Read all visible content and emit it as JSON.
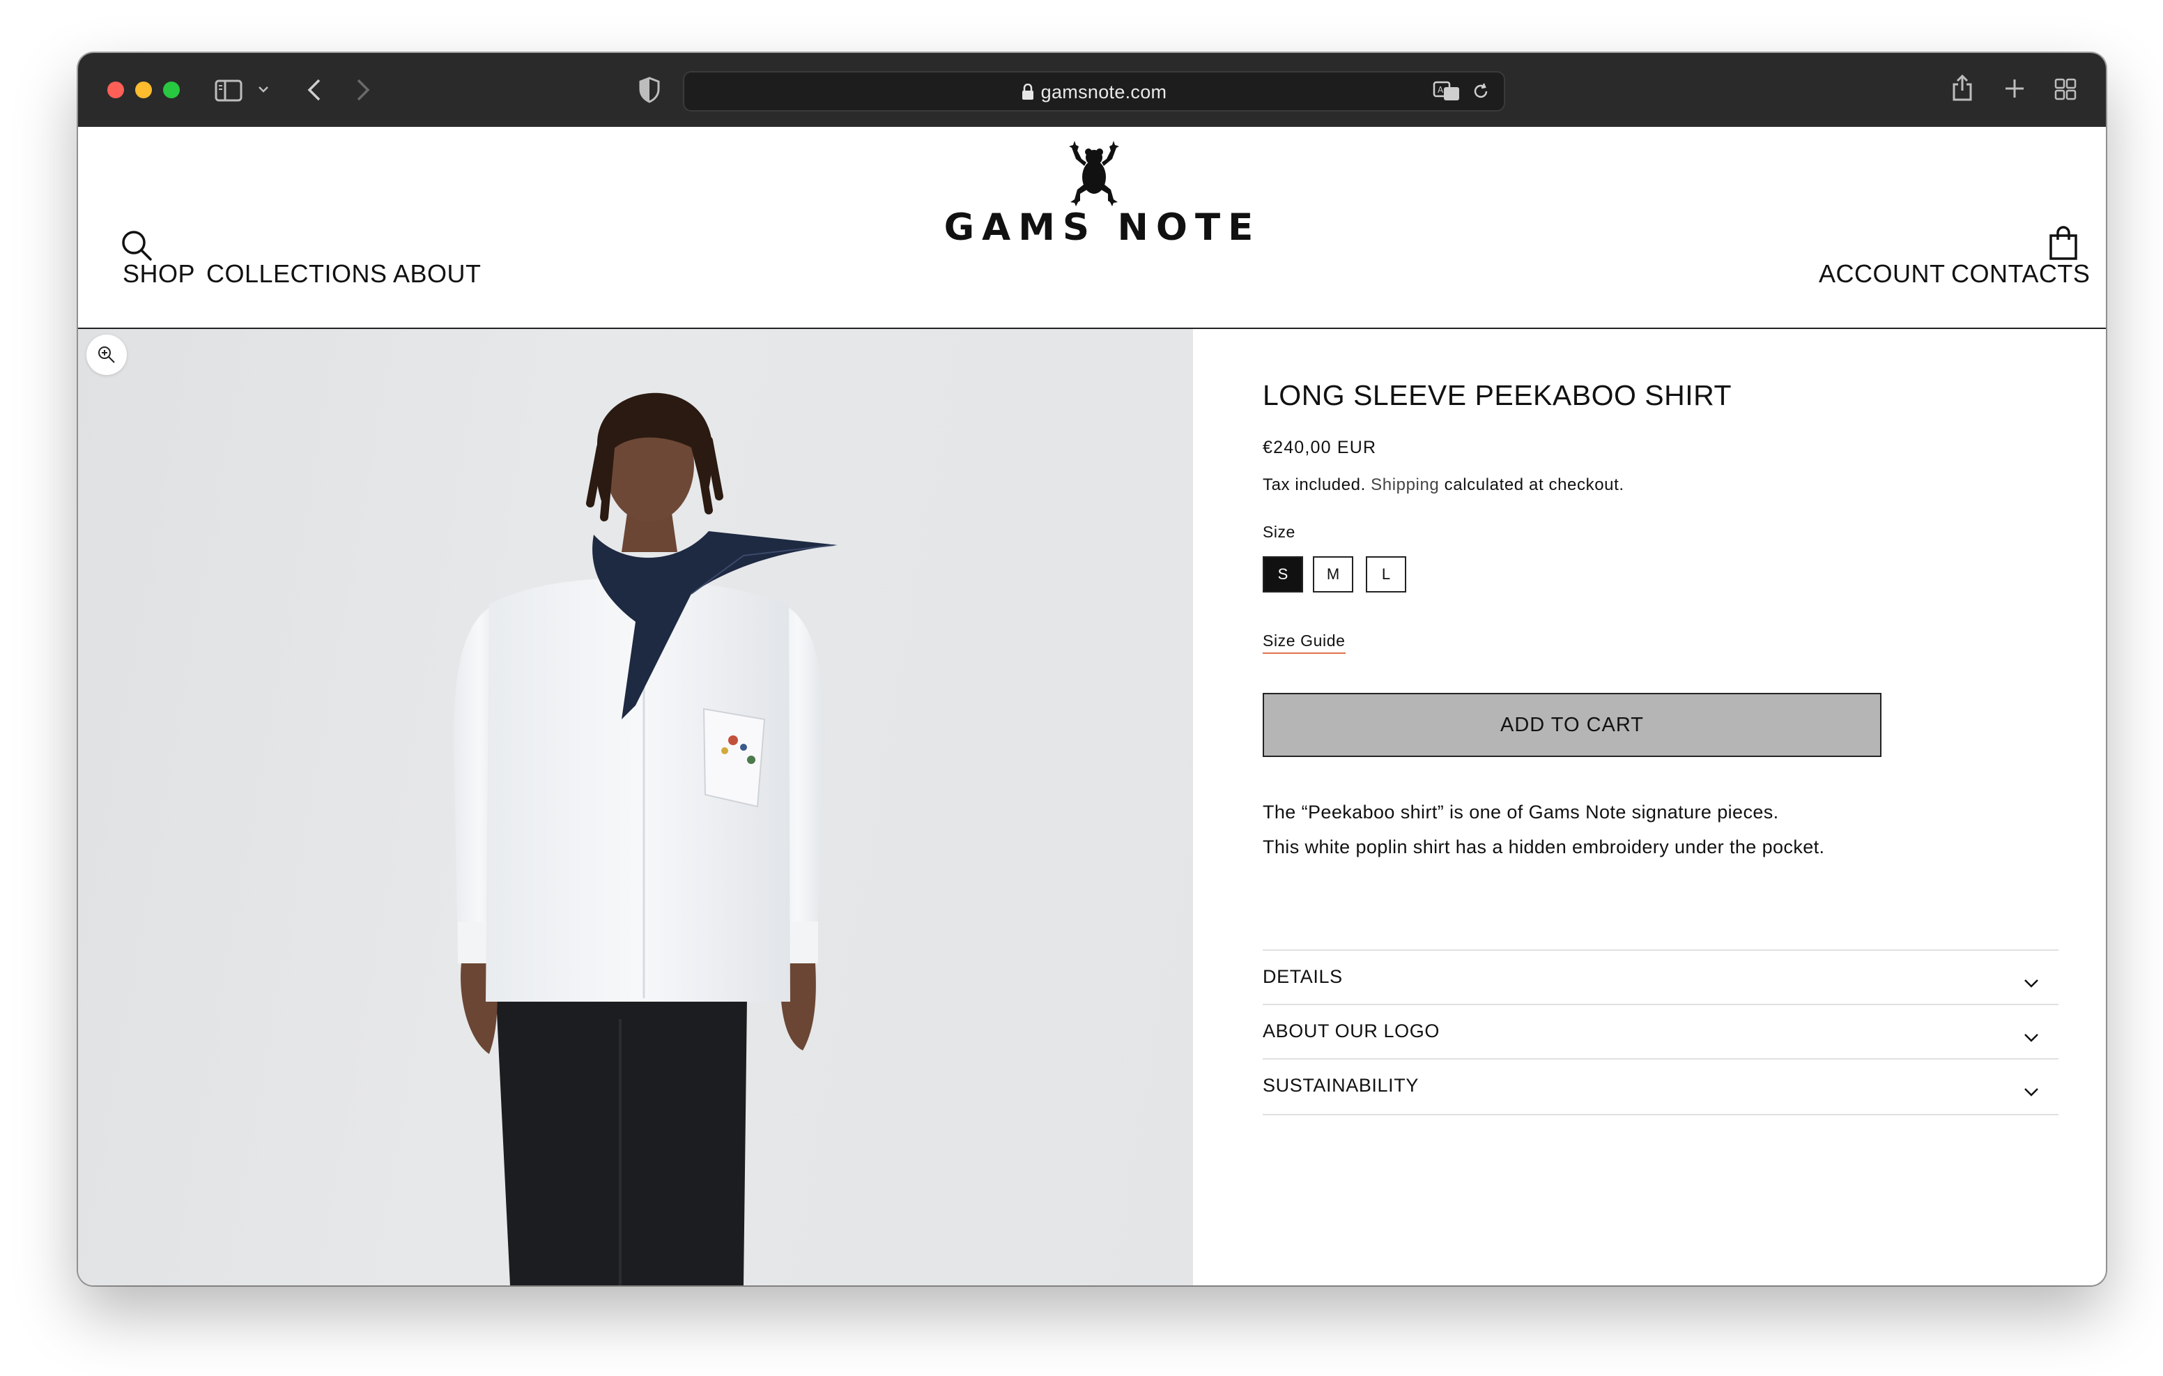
{
  "browser": {
    "url": "gamsnote.com"
  },
  "header": {
    "logo_text": "GAMS NOTE",
    "nav_left": [
      "SHOP",
      "COLLECTIONS",
      "ABOUT"
    ],
    "nav_right": [
      "ACCOUNT",
      "CONTACTS"
    ]
  },
  "product": {
    "title": "LONG SLEEVE PEEKABOO SHIRT",
    "price": "€240,00 EUR",
    "tax_prefix": "Tax included.",
    "tax_link": "Shipping",
    "tax_suffix": "calculated at checkout.",
    "size_label": "Size",
    "sizes": [
      "S",
      "M",
      "L"
    ],
    "selected_size": "S",
    "size_guide": "Size Guide",
    "add_to_cart": "ADD TO CART",
    "description": [
      "The “Peekaboo shirt” is one of Gams Note signature pieces.",
      "This white poplin shirt has a hidden embroidery under the pocket."
    ],
    "accordions": [
      "DETAILS",
      "ABOUT OUR LOGO",
      "SUSTAINABILITY"
    ]
  },
  "icons": {
    "search": "search-icon",
    "bag": "shopping-bag-icon",
    "zoom": "zoom-in-icon",
    "chevron": "chevron-down-icon"
  },
  "colors": {
    "chrome_bg": "#2a2a2a",
    "cart_button_bg": "#b5b5b5",
    "selected_size_bg": "#111111",
    "size_guide_underline": "#e2714a"
  }
}
